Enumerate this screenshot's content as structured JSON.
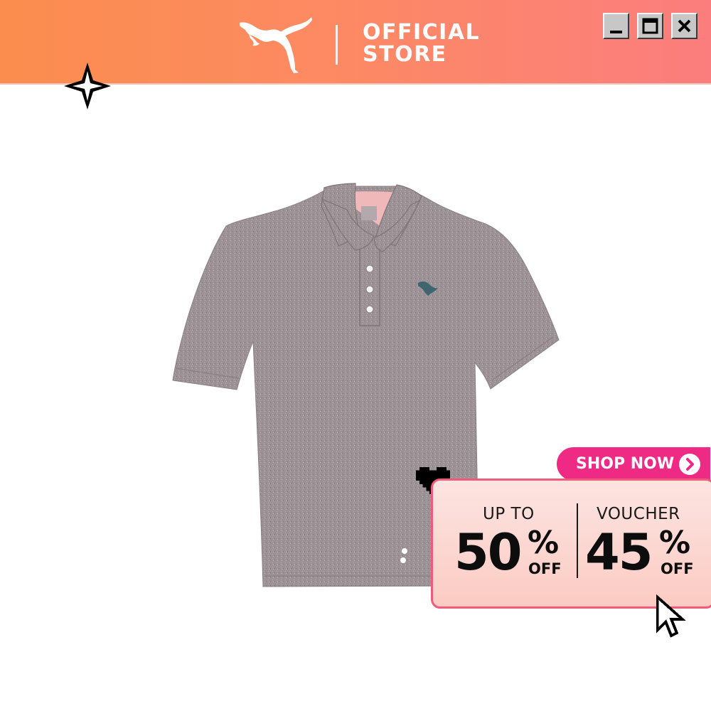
{
  "header": {
    "brand": "PUMA",
    "store_line1": "OFFICIAL",
    "store_line2": "STORE"
  },
  "window_controls": [
    "minimize-icon",
    "maximize-icon",
    "close-icon"
  ],
  "promo": {
    "shop_now": "SHOP NOW",
    "left": {
      "label": "UP TO",
      "value": "50",
      "percent": "%",
      "suffix": "OFF"
    },
    "right": {
      "label": "VOUCHER",
      "value": "45",
      "percent": "%",
      "suffix": "OFF"
    }
  },
  "colors": {
    "header_start": "#fb8d4e",
    "header_end": "#fb7d7e",
    "shop_button": "#ee2a85",
    "card_border": "#f05b7a",
    "shirt": "#9a8e92",
    "collar_lining": "#f0b7b8"
  },
  "icons": [
    "puma-logo-icon",
    "sparkle-icon",
    "heart-icon",
    "chevron-right-icon",
    "mouse-pointer-icon"
  ]
}
